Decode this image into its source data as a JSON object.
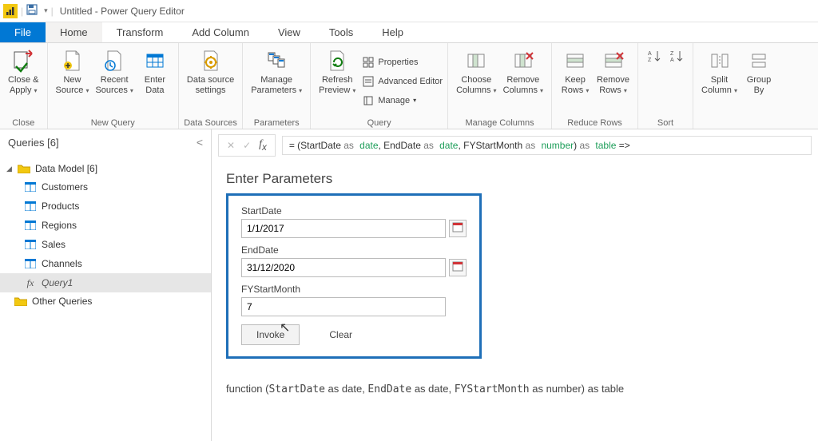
{
  "titlebar": {
    "title": "Untitled - Power Query Editor"
  },
  "tabs": {
    "file": "File",
    "home": "Home",
    "transform": "Transform",
    "addcol": "Add Column",
    "view": "View",
    "tools": "Tools",
    "help": "Help"
  },
  "ribbon": {
    "close": {
      "closeapply": "Close &\nApply",
      "group": "Close"
    },
    "newquery": {
      "newsource": "New\nSource",
      "recent": "Recent\nSources",
      "enter": "Enter\nData",
      "group": "New Query"
    },
    "datasources": {
      "settings": "Data source\nsettings",
      "group": "Data Sources"
    },
    "parameters": {
      "manage": "Manage\nParameters",
      "group": "Parameters"
    },
    "query": {
      "refresh": "Refresh\nPreview",
      "properties": "Properties",
      "advanced": "Advanced Editor",
      "manage": "Manage",
      "group": "Query"
    },
    "managecols": {
      "choose": "Choose\nColumns",
      "remove": "Remove\nColumns",
      "group": "Manage Columns"
    },
    "reducerows": {
      "keep": "Keep\nRows",
      "remove": "Remove\nRows",
      "group": "Reduce Rows"
    },
    "sort": {
      "group": "Sort"
    },
    "split": {
      "split": "Split\nColumn",
      "groupby": "Group\nBy"
    }
  },
  "sidebar": {
    "title": "Queries [6]",
    "folder": "Data Model [6]",
    "items": [
      "Customers",
      "Products",
      "Regions",
      "Sales",
      "Channels",
      "Query1"
    ],
    "other": "Other Queries"
  },
  "formula": {
    "prefix": "= (StartDate ",
    "as1": "as",
    "t1": "date",
    "m1": ", EndDate ",
    "as2": "as",
    "t2": "date",
    "m2": ", FYStartMonth ",
    "as3": "as",
    "t3": "number",
    "m3": ") ",
    "as4": "as",
    "t4": "table",
    "tail": " =>"
  },
  "params": {
    "title": "Enter Parameters",
    "f1": {
      "label": "StartDate",
      "value": "1/1/2017"
    },
    "f2": {
      "label": "EndDate",
      "value": "31/12/2020"
    },
    "f3": {
      "label": "FYStartMonth",
      "value": "7"
    },
    "invoke": "Invoke",
    "clear": "Clear"
  },
  "signature": {
    "pre": "function (",
    "p1": "StartDate",
    "as": " as date, ",
    "p2": "EndDate",
    "as2": " as date, ",
    "p3": "FYStartMonth",
    "as3": " as number) as table"
  }
}
